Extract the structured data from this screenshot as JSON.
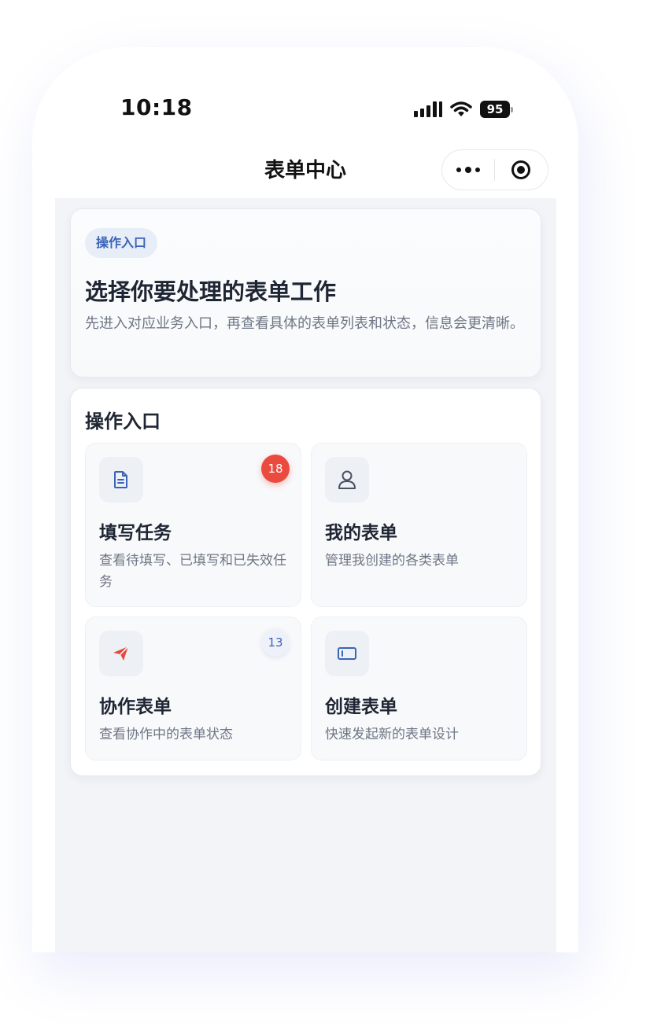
{
  "status_bar": {
    "time": "10:18",
    "battery": "95"
  },
  "nav": {
    "title": "表单中心"
  },
  "intro": {
    "tag": "操作入口",
    "title": "选择你要处理的表单工作",
    "description": "先进入对应业务入口，再查看具体的表单列表和状态，信息会更清晰。"
  },
  "entries": {
    "title": "操作入口",
    "tiles": [
      {
        "title": "填写任务",
        "description": "查看待填写、已填写和已失效任务",
        "badge": "18",
        "badge_color": "#eb4b3f",
        "icon": "document-icon"
      },
      {
        "title": "我的表单",
        "description": "管理我创建的各类表单",
        "icon": "user-icon"
      },
      {
        "title": "协作表单",
        "description": "查看协作中的表单状态",
        "badge": "13",
        "badge_color": "#3b63b8",
        "icon": "paper-plane-icon"
      },
      {
        "title": "创建表单",
        "description": "快速发起新的表单设计",
        "icon": "form-icon"
      }
    ]
  },
  "colors": {
    "accent": "#3b63b8",
    "danger": "#eb4b3f",
    "background": "#f2f4f8"
  }
}
